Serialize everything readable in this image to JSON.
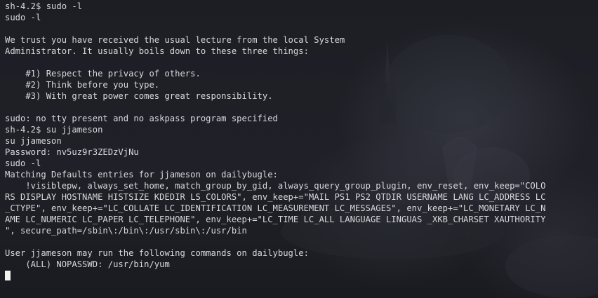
{
  "terminal": {
    "lines": [
      "sh-4.2$ sudo -l",
      "sudo -l",
      "",
      "We trust you have received the usual lecture from the local System",
      "Administrator. It usually boils down to these three things:",
      "",
      "    #1) Respect the privacy of others.",
      "    #2) Think before you type.",
      "    #3) With great power comes great responsibility.",
      "",
      "sudo: no tty present and no askpass program specified",
      "sh-4.2$ su jjameson",
      "su jjameson",
      "Password: nv5uz9r3ZEDzVjNu",
      "sudo -l",
      "Matching Defaults entries for jjameson on dailybugle:",
      "    !visiblepw, always_set_home, match_group_by_gid, always_query_group_plugin, env_reset, env_keep=\"COLO",
      "RS DISPLAY HOSTNAME HISTSIZE KDEDIR LS_COLORS\", env_keep+=\"MAIL PS1 PS2 QTDIR USERNAME LANG LC_ADDRESS LC",
      "_CTYPE\", env_keep+=\"LC_COLLATE LC_IDENTIFICATION LC_MEASUREMENT LC_MESSAGES\", env_keep+=\"LC_MONETARY LC_N",
      "AME LC_NUMERIC LC_PAPER LC_TELEPHONE\", env_keep+=\"LC_TIME LC_ALL LANGUAGE LINGUAS _XKB_CHARSET XAUTHORITY",
      "\", secure_path=/sbin\\:/bin\\:/usr/sbin\\:/usr/bin",
      "",
      "User jjameson may run the following commands on dailybugle:",
      "    (ALL) NOPASSWD: /usr/bin/yum"
    ]
  },
  "colors": {
    "background": "#1b1c21",
    "foreground": "#d8d8dc",
    "cursor": "#f2f2f2"
  }
}
